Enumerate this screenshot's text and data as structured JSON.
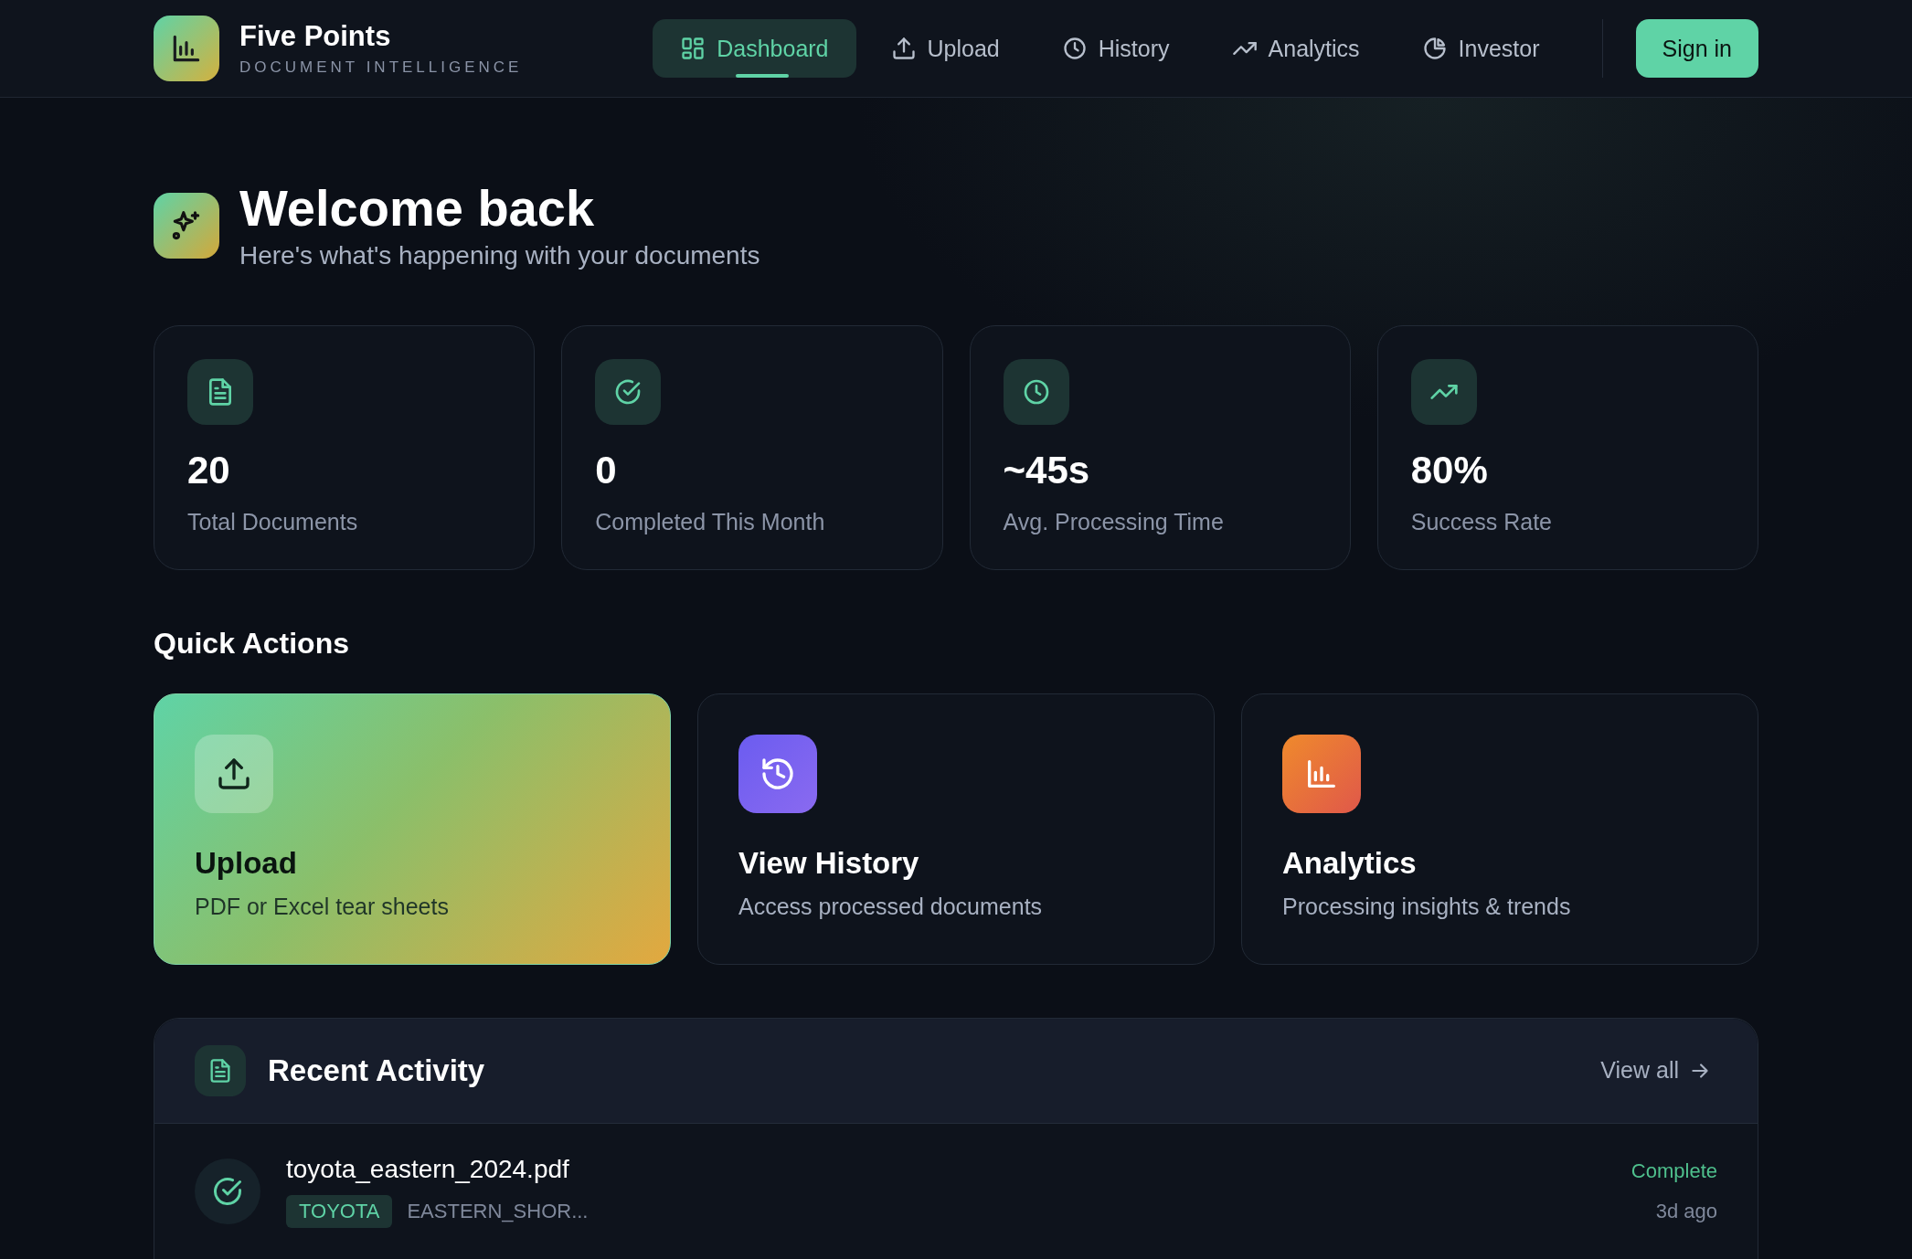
{
  "brand": {
    "name": "Five Points",
    "tagline": "DOCUMENT INTELLIGENCE"
  },
  "nav": [
    {
      "label": "Dashboard",
      "selected": true
    },
    {
      "label": "Upload",
      "selected": false
    },
    {
      "label": "History",
      "selected": false
    },
    {
      "label": "Analytics",
      "selected": false
    },
    {
      "label": "Investor",
      "selected": false
    }
  ],
  "sign_in": "Sign in",
  "welcome": {
    "title": "Welcome back",
    "subtitle": "Here's what's happening with your documents"
  },
  "stats": [
    {
      "value": "20",
      "label": "Total Documents"
    },
    {
      "value": "0",
      "label": "Completed This Month"
    },
    {
      "value": "~45s",
      "label": "Avg. Processing Time"
    },
    {
      "value": "80%",
      "label": "Success Rate"
    }
  ],
  "quick_actions": {
    "title": "Quick Actions",
    "items": [
      {
        "title": "Upload",
        "description": "PDF or Excel tear sheets",
        "kind": "featured"
      },
      {
        "title": "View History",
        "description": "Access processed documents",
        "kind": "plain"
      },
      {
        "title": "Analytics",
        "description": "Processing insights & trends",
        "kind": "plain"
      }
    ]
  },
  "recent_activity": {
    "title": "Recent Activity",
    "view_all": "View all",
    "items": [
      {
        "filename": "toyota_eastern_2024.pdf",
        "tag": "TOYOTA",
        "detail": "EASTERN_SHOR...",
        "status": "Complete",
        "time": "3d ago"
      }
    ]
  }
}
